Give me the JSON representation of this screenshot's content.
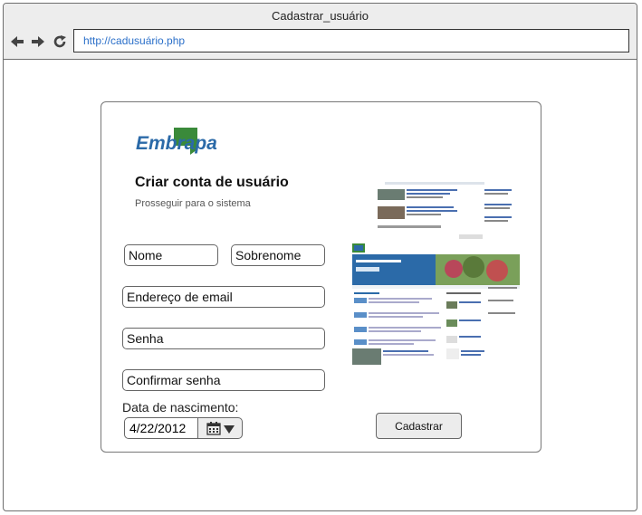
{
  "window": {
    "title": "Cadastrar_usuário"
  },
  "browser": {
    "url": "http://cadusuário.php"
  },
  "brand": {
    "logo_text": "Embrapa",
    "logo_color": "#2b6aa8",
    "logo_accent": "#3a8a3a"
  },
  "form": {
    "title": "Criar conta de usuário",
    "subtitle": "Prosseguir para o sistema",
    "first_name": "Nome",
    "last_name": "Sobrenome",
    "email": "Endereço de email",
    "password": "Senha",
    "confirm_password": "Confirmar senha",
    "dob_label": "Data de nascimento:",
    "dob_value": "4/22/2012",
    "submit_label": "Cadastrar"
  },
  "icons": {
    "back": "arrow-left-icon",
    "forward": "arrow-right-icon",
    "reload": "reload-icon",
    "calendar": "calendar-icon",
    "dropdown": "caret-down-icon"
  }
}
